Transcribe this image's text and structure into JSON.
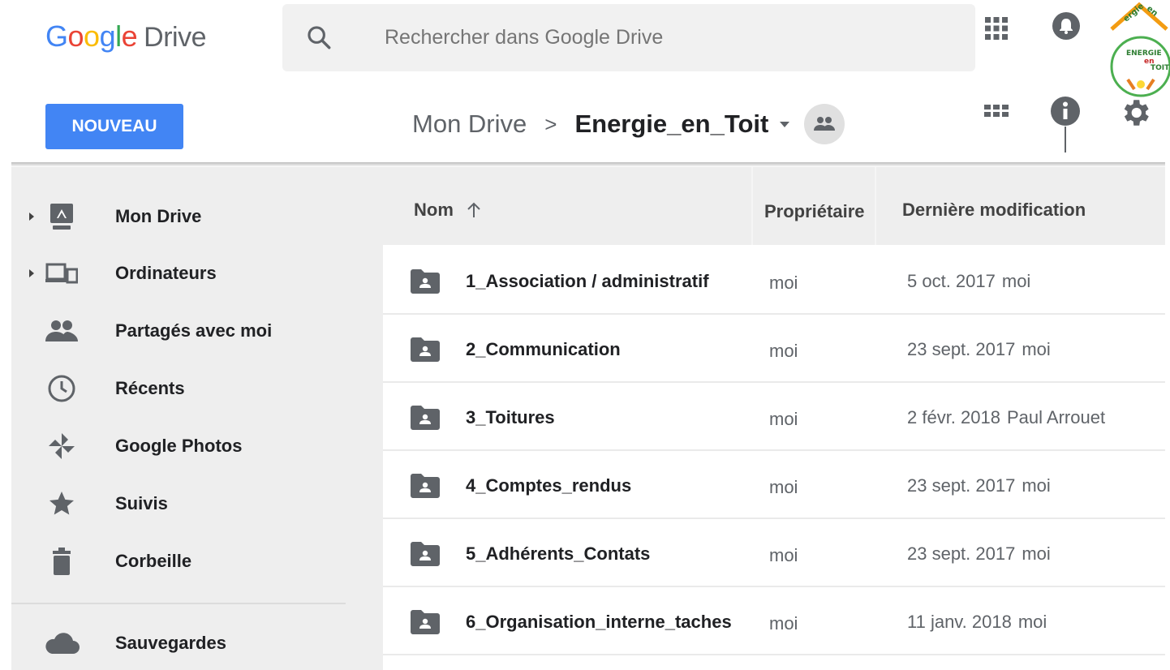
{
  "app": {
    "logo_letters": [
      "G",
      "o",
      "o",
      "g",
      "l",
      "e"
    ],
    "logo_product": "Drive"
  },
  "search": {
    "placeholder": "Rechercher dans Google Drive",
    "value": ""
  },
  "header": {
    "new_button": "NOUVEAU",
    "breadcrumb_root": "Mon Drive",
    "breadcrumb_separator": ">",
    "breadcrumb_current": "Energie_en_Toit",
    "account_logo_text": "ENERGIE en TOIT"
  },
  "sidebar": {
    "items": [
      {
        "label": "Mon Drive",
        "icon": "drive-icon",
        "expandable": true
      },
      {
        "label": "Ordinateurs",
        "icon": "computers-icon",
        "expandable": true
      },
      {
        "label": "Partagés avec moi",
        "icon": "shared-people-icon",
        "expandable": false
      },
      {
        "label": "Récents",
        "icon": "clock-icon",
        "expandable": false
      },
      {
        "label": "Google Photos",
        "icon": "pinwheel-icon",
        "expandable": false
      },
      {
        "label": "Suivis",
        "icon": "star-icon",
        "expandable": false
      },
      {
        "label": "Corbeille",
        "icon": "trash-icon",
        "expandable": false
      },
      {
        "label": "Sauvegardes",
        "icon": "cloud-icon",
        "expandable": false
      }
    ]
  },
  "list": {
    "columns": {
      "name": "Nom",
      "owner": "Propriétaire",
      "modified": "Dernière modification"
    },
    "sort": "ascending",
    "rows": [
      {
        "name": "1_Association / administratif",
        "owner": "moi",
        "date": "5 oct. 2017",
        "by": "moi"
      },
      {
        "name": "2_Communication",
        "owner": "moi",
        "date": "23 sept. 2017",
        "by": "moi"
      },
      {
        "name": "3_Toitures",
        "owner": "moi",
        "date": "2 févr. 2018",
        "by": "Paul Arrouet"
      },
      {
        "name": "4_Comptes_rendus",
        "owner": "moi",
        "date": "23 sept. 2017",
        "by": "moi"
      },
      {
        "name": "5_Adhérents_Contats",
        "owner": "moi",
        "date": "23 sept. 2017",
        "by": "moi"
      },
      {
        "name": "6_Organisation_interne_taches",
        "owner": "moi",
        "date": "11 janv. 2018",
        "by": "moi"
      }
    ]
  },
  "colors": {
    "primary": "#4285f4",
    "sidebar_bg": "#eeeeee",
    "icon_grey": "#616161"
  }
}
